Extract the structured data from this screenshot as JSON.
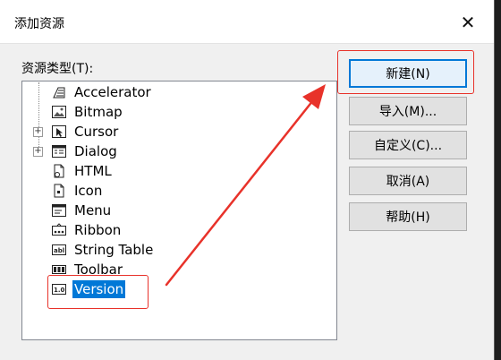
{
  "dialog": {
    "title": "添加资源",
    "close_glyph": "✕",
    "list_label": "资源类型(T):"
  },
  "resource_types": [
    {
      "label": "Accelerator",
      "icon": "accelerator-icon",
      "expandable": false,
      "selected": false
    },
    {
      "label": "Bitmap",
      "icon": "bitmap-icon",
      "expandable": false,
      "selected": false
    },
    {
      "label": "Cursor",
      "icon": "cursor-icon",
      "expandable": true,
      "selected": false
    },
    {
      "label": "Dialog",
      "icon": "dialog-icon",
      "expandable": true,
      "selected": false
    },
    {
      "label": "HTML",
      "icon": "html-icon",
      "expandable": false,
      "selected": false
    },
    {
      "label": "Icon",
      "icon": "icon-icon",
      "expandable": false,
      "selected": false
    },
    {
      "label": "Menu",
      "icon": "menu-icon",
      "expandable": false,
      "selected": false
    },
    {
      "label": "Ribbon",
      "icon": "ribbon-icon",
      "expandable": false,
      "selected": false
    },
    {
      "label": "String Table",
      "icon": "string-table-icon",
      "expandable": false,
      "selected": false
    },
    {
      "label": "Toolbar",
      "icon": "toolbar-icon",
      "expandable": false,
      "selected": false
    },
    {
      "label": "Version",
      "icon": "version-icon",
      "expandable": false,
      "selected": true
    }
  ],
  "buttons": {
    "new": "新建(N)",
    "import": "导入(M)...",
    "custom": "自定义(C)...",
    "cancel": "取消(A)",
    "help": "帮助(H)"
  },
  "expander_glyph": "+",
  "icon_texts": {
    "string_table": "abl",
    "version": "1.0"
  },
  "colors": {
    "selection": "#0078d7",
    "annotation": "#e8322a",
    "primary_border": "#0078d7"
  }
}
